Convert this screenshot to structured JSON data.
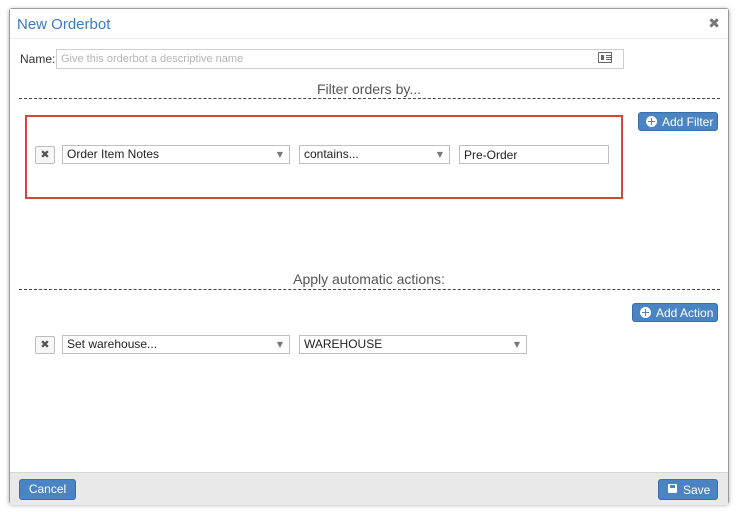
{
  "dialog": {
    "title": "New Orderbot",
    "close_icon": "close-icon"
  },
  "name_field": {
    "label": "Name:",
    "placeholder": "Give this orderbot a descriptive name",
    "value": "",
    "icon": "id-card-icon"
  },
  "filters": {
    "heading": "Filter orders by...",
    "add_button": "Add Filter",
    "rows": [
      {
        "field": "Order Item Notes",
        "operator": "contains...",
        "value": "Pre-Order"
      }
    ]
  },
  "actions": {
    "heading": "Apply automatic actions:",
    "add_button": "Add Action",
    "rows": [
      {
        "action": "Set warehouse...",
        "value": "WAREHOUSE"
      }
    ]
  },
  "footer": {
    "cancel_label": "Cancel",
    "save_label": "Save"
  },
  "colors": {
    "accent": "#4a84c3",
    "highlight_border": "#d9473a",
    "title": "#3a7bc0"
  }
}
